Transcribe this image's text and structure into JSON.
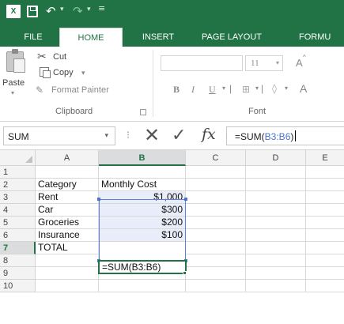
{
  "titlebar": {
    "app_icon": "X",
    "accent": "#217346"
  },
  "tabs": [
    {
      "label": "FILE",
      "active": false
    },
    {
      "label": "HOME",
      "active": true
    },
    {
      "label": "INSERT",
      "active": false
    },
    {
      "label": "PAGE LAYOUT",
      "active": false
    },
    {
      "label": "FORMU",
      "active": false
    }
  ],
  "ribbon": {
    "clipboard": {
      "paste_label": "Paste",
      "cut_label": "Cut",
      "copy_label": "Copy",
      "format_painter_label": "Format Painter",
      "group_label": "Clipboard"
    },
    "font": {
      "size": "11",
      "bold_label": "B",
      "italic_label": "I",
      "underline_label": "U",
      "grow_label": "A",
      "color_label": "A",
      "group_label": "Font"
    }
  },
  "formula_bar": {
    "name_box": "SUM",
    "fx_label": "fx",
    "formula_prefix": "=SUM(",
    "formula_ref": "B3:B6",
    "formula_suffix": ")",
    "ref_color": "#4a74cf"
  },
  "grid": {
    "columns": [
      "A",
      "B",
      "C",
      "D",
      "E"
    ],
    "selected_column": "B",
    "rows": [
      "1",
      "2",
      "3",
      "4",
      "5",
      "6",
      "7",
      "8",
      "9",
      "10"
    ],
    "selected_row": "7",
    "cells": {
      "a2": "Category",
      "b2": "Monthly Cost",
      "a3": "Rent",
      "b3": "$1,000",
      "a4": "Car",
      "b4": "$300",
      "a5": "Groceries",
      "b5": "$200",
      "a6": "Insurance",
      "b6": "$100",
      "a7": "TOTAL",
      "b7": "=SUM(B3:B6)"
    }
  }
}
